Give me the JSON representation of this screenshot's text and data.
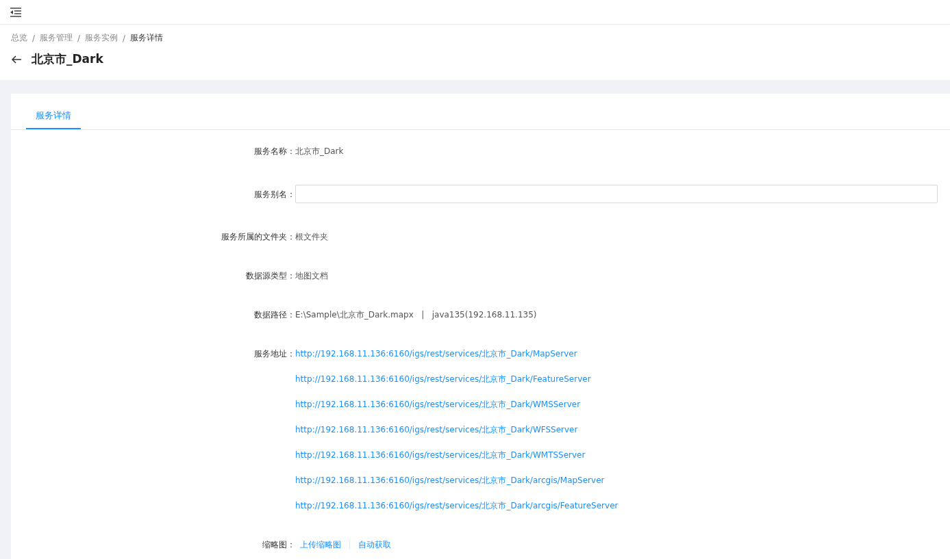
{
  "breadcrumb": {
    "separator": "/",
    "items": [
      {
        "label": "总览",
        "current": false
      },
      {
        "label": "服务管理",
        "current": false
      },
      {
        "label": "服务实例",
        "current": false
      },
      {
        "label": "服务详情",
        "current": true
      }
    ]
  },
  "page_title": "北京市_Dark",
  "tabs": [
    {
      "label": "服务详情",
      "selected": true
    }
  ],
  "fields": [
    {
      "kind": "text",
      "label": "服务名称：",
      "value": "北京市_Dark"
    },
    {
      "kind": "input",
      "label": "服务别名："
    },
    {
      "kind": "text",
      "label": "服务所属的文件夹：",
      "value": "根文件夹"
    },
    {
      "kind": "text",
      "label": "数据源类型：",
      "value": "地图文档"
    },
    {
      "kind": "text",
      "label": "数据路径：",
      "value": "E:\\Sample\\北京市_Dark.mapx   |   java135(192.168.11.135)"
    },
    {
      "kind": "links",
      "label": "服务地址：",
      "links": [
        "http://192.168.11.136:6160/igs/rest/services/北京市_Dark/MapServer",
        "http://192.168.11.136:6160/igs/rest/services/北京市_Dark/FeatureServer",
        "http://192.168.11.136:6160/igs/rest/services/北京市_Dark/WMSServer",
        "http://192.168.11.136:6160/igs/rest/services/北京市_Dark/WFSServer",
        "http://192.168.11.136:6160/igs/rest/services/北京市_Dark/WMTSServer",
        "http://192.168.11.136:6160/igs/rest/services/北京市_Dark/arcgis/MapServer",
        "http://192.168.11.136:6160/igs/rest/services/北京市_Dark/arcgis/FeatureServer"
      ]
    },
    {
      "kind": "actions",
      "label": "缩略图：",
      "actions": [
        "上传缩略图",
        "自动获取"
      ]
    }
  ]
}
